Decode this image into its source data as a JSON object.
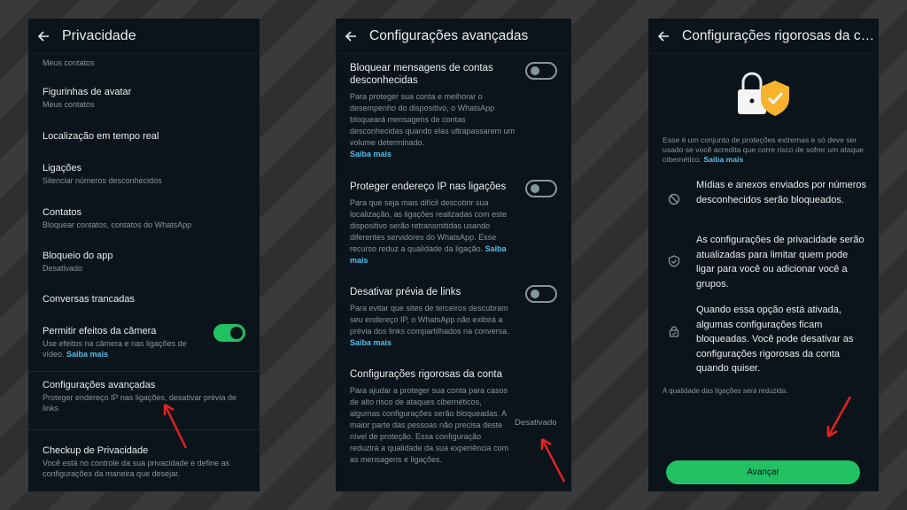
{
  "panel1": {
    "title": "Privacidade",
    "cut_sub": "Meus contatos",
    "items": [
      {
        "title": "Figurinhas de avatar",
        "sub": "Meus contatos"
      },
      {
        "title": "Localização em tempo real",
        "sub": ""
      },
      {
        "title": "Ligações",
        "sub": "Silenciar números desconhecidos"
      },
      {
        "title": "Contatos",
        "sub": "Bloquear contatos, contatos do WhatsApp"
      },
      {
        "title": "Bloqueio do app",
        "sub": "Desativado"
      },
      {
        "title": "Conversas trancadas",
        "sub": ""
      }
    ],
    "camera": {
      "title": "Permitir efeitos da câmera",
      "sub": "Use efeitos na câmera e nas ligações de vídeo.",
      "link": "Saiba mais",
      "enabled": true
    },
    "advanced": {
      "title": "Configurações avançadas",
      "sub": "Proteger endereço IP nas ligações, desativar prévia de links"
    },
    "checkup": {
      "title": "Checkup de Privacidade",
      "sub": "Você está no controle da sua privacidade e define as configurações da maneira que desejar."
    }
  },
  "panel2": {
    "title": "Configurações avançadas",
    "items": [
      {
        "title": "Bloquear mensagens de contas desconhecidas",
        "desc": "Para proteger sua conta e melhorar o desempenho do dispositivo, o WhatsApp bloqueará mensagens de contas desconhecidas quando elas ultrapassarem um volume determinado.",
        "link": "Saiba mais",
        "enabled": false
      },
      {
        "title": "Proteger endereço IP nas ligações",
        "desc": "Para que seja mais difícil descobrir sua localização, as ligações realizadas com este dispositivo serão retransmitidas usando diferentes servidores do WhatsApp. Esse recurso reduz a qualidade da ligação.",
        "link": "Saiba mais",
        "enabled": false
      },
      {
        "title": "Desativar prévia de links",
        "desc": "Para evitar que sites de terceiros descubram seu endereço IP, o WhatsApp não exibirá a prévia dos links compartilhados na conversa.",
        "link": "Saiba mais",
        "enabled": false
      },
      {
        "title": "Configurações rigorosas da conta",
        "desc": "Para ajudar a proteger sua conta para casos de alto risco de ataques cibernéticos, algumas configurações serão bloqueadas. A maior parte das pessoas não precisa deste nível de proteção. Essa configuração reduzirá a qualidade da sua experiência com as mensagens e ligações.",
        "status": "Desativado"
      }
    ]
  },
  "panel3": {
    "title": "Configurações rigorosas da co...",
    "intro": "Esse é um conjunto de proteções extremas e só deve ser usado se você acredita que corre risco de sofrer um ataque cibernético.",
    "intro_link": "Saiba mais",
    "features": [
      {
        "icon": "block-icon",
        "text": "Mídias e anexos enviados por números desconhecidos serão bloqueados."
      },
      {
        "icon": "shield-icon",
        "text": "As configurações de privacidade serão atualizadas para limitar quem pode ligar para você ou adicionar você a grupos."
      },
      {
        "icon": "lock-icon",
        "text": "Quando essa opção está ativada, algumas configurações ficam bloqueadas. Você pode desativar as configurações rigorosas da conta quando quiser."
      }
    ],
    "note": "A qualidade das ligações será reduzida.",
    "button": "Avançar"
  },
  "colors": {
    "accent": "#21c063",
    "link": "#53bdeb",
    "bg": "#0b141a",
    "arrow": "#e02424"
  }
}
